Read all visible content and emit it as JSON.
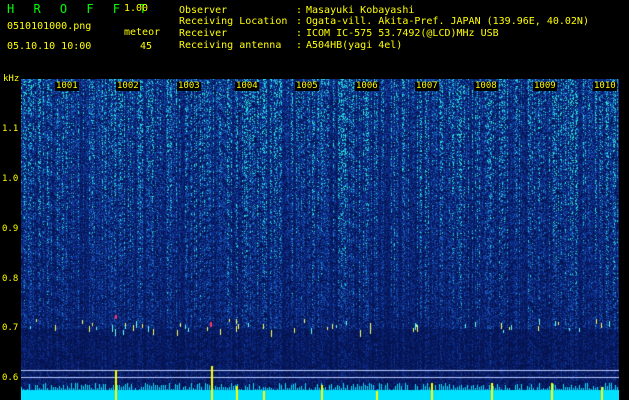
{
  "header": {
    "app_title": "H R O F F T",
    "app_version": "1.00",
    "file_name": "0510101000.png",
    "date_time": "05.10.10 10:00",
    "meteor_label": "meteor",
    "meteor_count": "45"
  },
  "info": [
    {
      "label": "Observer",
      "colon": ":",
      "value": "Masayuki Kobayashi"
    },
    {
      "label": "Receiving Location",
      "colon": ":",
      "value": "Ogata-vill. Akita-Pref. JAPAN (139.96E, 40.02N)"
    },
    {
      "label": "Receiver",
      "colon": ":",
      "value": "ICOM IC-575 53.7492(@LCD)MHz USB"
    },
    {
      "label": "Receiving antenna",
      "colon": ":",
      "value": "A504HB(yagi 4el)"
    }
  ],
  "axis": {
    "y_unit": "kHz",
    "y_ticks": [
      "1.1",
      "1.0",
      "0.9",
      "0.8",
      "0.7",
      "0.6"
    ],
    "x_ticks": [
      "1001",
      "1002",
      "1003",
      "1004",
      "1005",
      "1006",
      "1007",
      "1008",
      "1009",
      "1010"
    ]
  },
  "colors": {
    "background": "#000000",
    "text": "#ffff00",
    "title": "#00ff00",
    "spectrum_low": "#0a1e6e",
    "spectrum_high": "#00ffff"
  }
}
